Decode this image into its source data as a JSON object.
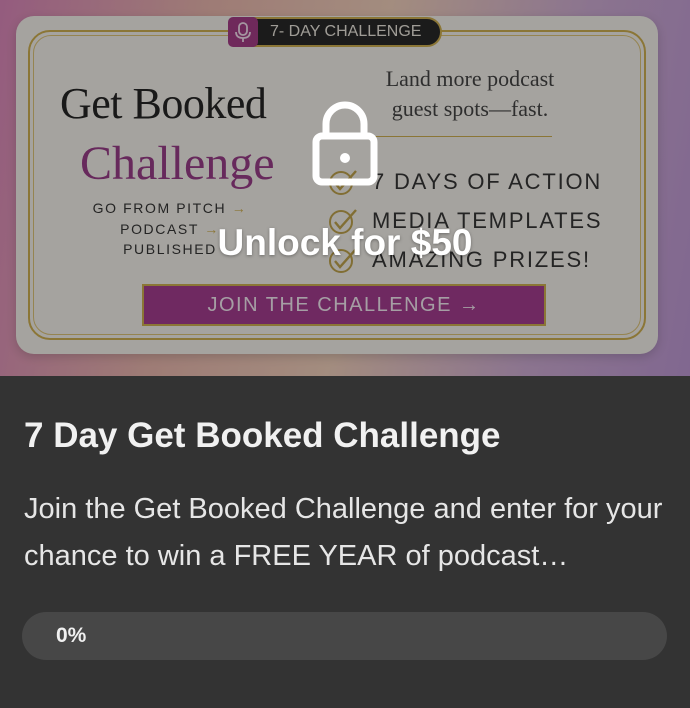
{
  "hero": {
    "pill_text": "7- DAY CHALLENGE",
    "heading": "Get Booked",
    "subheading": "Challenge",
    "small_lines": [
      "GO FROM PITCH",
      "PODCAST",
      "PUBLISHED"
    ],
    "small_arrow": "→",
    "tagline_lines": [
      "Land more podcast",
      "guest spots—fast."
    ],
    "checklist": [
      "7 DAYS OF ACTION",
      "MEDIA TEMPLATES",
      "AMAZING PRIZES!"
    ],
    "join_button": "JOIN THE CHALLENGE →",
    "lock_icon": "lock-icon",
    "unlock_label": "Unlock for $50"
  },
  "card": {
    "title": "7 Day Get Booked Challenge",
    "description": "Join the Get Booked Challenge and enter for your chance to win a FREE YEAR of podcast…",
    "progress_percent": 0,
    "progress_label": "0%"
  },
  "colors": {
    "brand_magenta": "#9b2b85",
    "gold": "#c9a640",
    "card_background": "#333333",
    "progress_track": "#474747"
  }
}
